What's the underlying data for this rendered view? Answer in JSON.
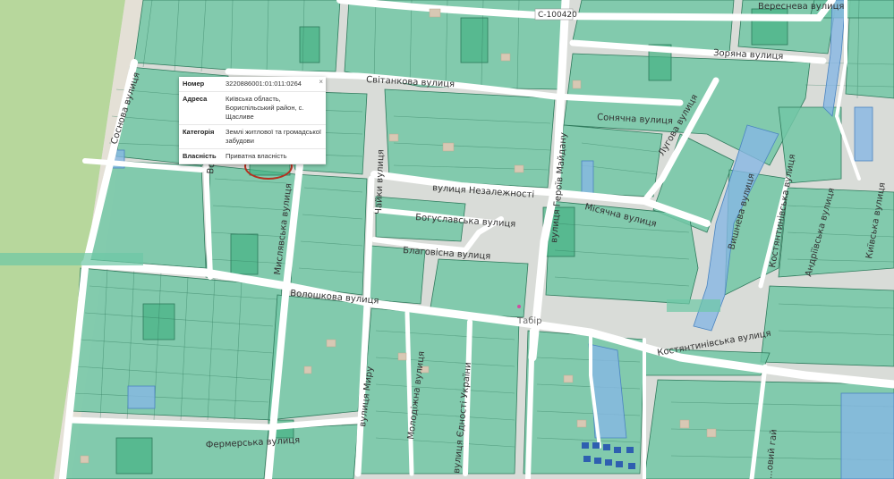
{
  "map": {
    "streets": [
      {
        "id": "veresneva",
        "label": "Вереснева вулиця"
      },
      {
        "id": "zoriana",
        "label": "Зоряна вулиця"
      },
      {
        "id": "svitankova",
        "label": "Світанкова вулиця"
      },
      {
        "id": "sonyachna",
        "label": "Сонячна вулиця"
      },
      {
        "id": "luhova",
        "label": "Лугова вулиця"
      },
      {
        "id": "nezalezhnosti",
        "label": "вулиця Незалежності"
      },
      {
        "id": "misiachna",
        "label": "Місячна вулиця"
      },
      {
        "id": "bohuslavska",
        "label": "Богуславська вулиця"
      },
      {
        "id": "blahovisna",
        "label": "Благовісна вулиця"
      },
      {
        "id": "voloshkova",
        "label": "Волошкова вулиця"
      },
      {
        "id": "myslavska",
        "label": "Мислявська вулиця"
      },
      {
        "id": "chaiky",
        "label": "Чайки вулиця"
      },
      {
        "id": "heroiv-maidanu",
        "label": "вулиця Героїв Майдану"
      },
      {
        "id": "vyshneva",
        "label": "Вишнева вулиця"
      },
      {
        "id": "kyivska",
        "label": "Київська вулиця"
      },
      {
        "id": "sosnova",
        "label": "Соснова вулиця"
      },
      {
        "id": "myru",
        "label": "вулиця Миру"
      },
      {
        "id": "molodizhna",
        "label": "Молодіжна вулиця"
      },
      {
        "id": "yednosti",
        "label": "вулиця Єдності України"
      },
      {
        "id": "kostiantynivska",
        "label": "Костянтинівська вулиця"
      },
      {
        "id": "kostiantynivska-2",
        "label": "Костянтинівська вулиця"
      },
      {
        "id": "andriivska",
        "label": "Андріївська вулиця"
      },
      {
        "id": "fermerska",
        "label": "Фермерська вулиця"
      },
      {
        "id": "volzhska",
        "label": "Вол..."
      },
      {
        "id": "hai",
        "label": "...овий гай"
      }
    ],
    "road_ref": "C-100420",
    "place": "Табір"
  },
  "popup": {
    "rows": [
      {
        "key": "Номер",
        "value": "3220886001:01:011:0264"
      },
      {
        "key": "Адреса",
        "value": "Київська область, Бориспільський район, с. Щасливе"
      },
      {
        "key": "Категорія",
        "value": "Землі житлової та громадської забудови"
      },
      {
        "key": "Власність",
        "value": "Приватна власність"
      }
    ],
    "close_label": "×"
  },
  "colors": {
    "parcel": "#72c7a6",
    "parcel_dark": "#4bb88a",
    "water": "#86b7e3",
    "forest": "#b3d698",
    "road": "#ffffff",
    "marker": "#b5301f"
  }
}
